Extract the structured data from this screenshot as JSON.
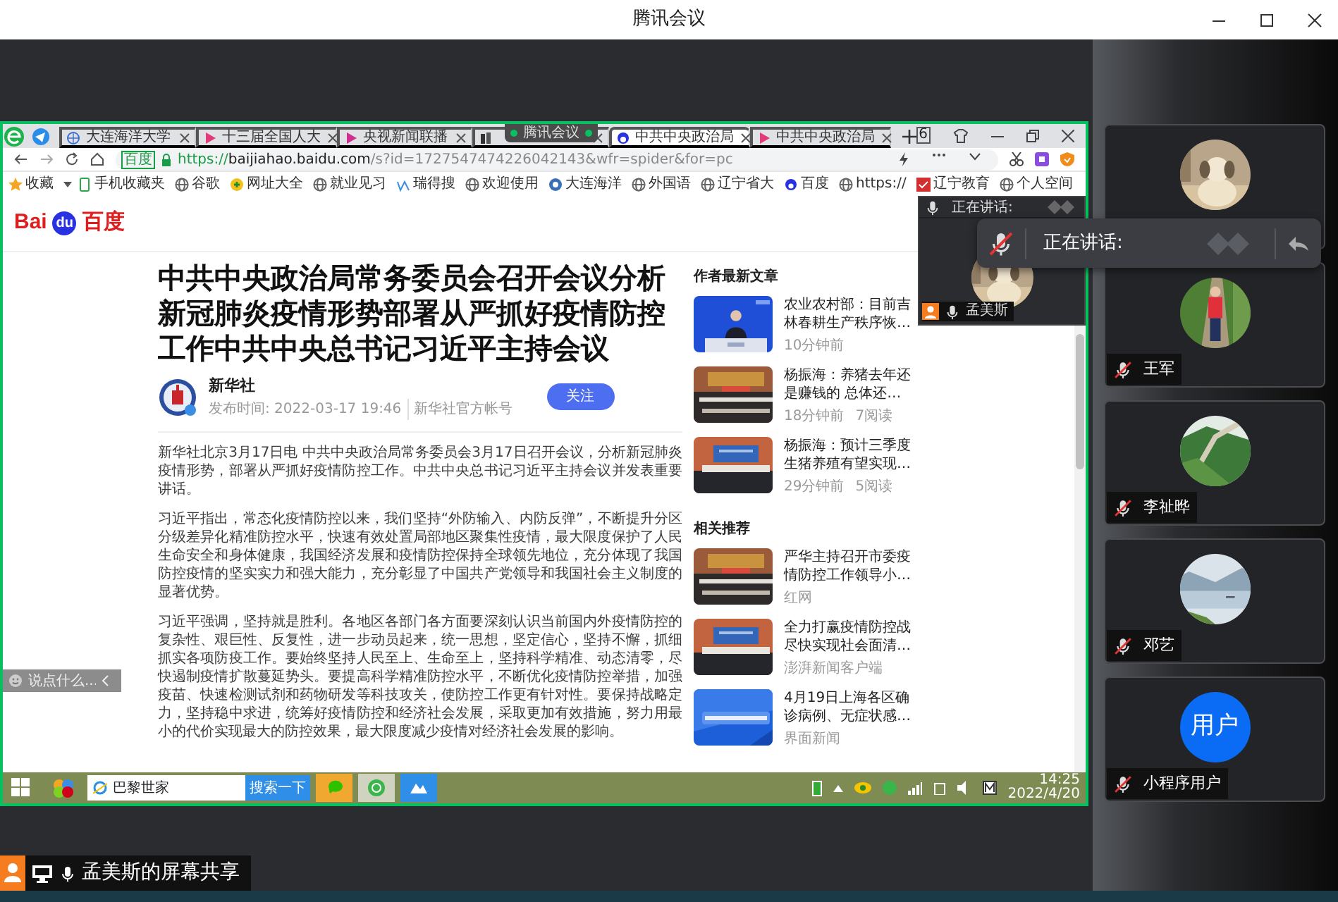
{
  "window": {
    "title": "腾讯会议"
  },
  "shared_screen": {
    "browser": {
      "tabs": [
        {
          "label": "大连海洋大学",
          "selected": false
        },
        {
          "label": "十三届全国人大",
          "selected": false
        },
        {
          "label": "央视新闻联播",
          "selected": false
        },
        {
          "selected": false
        },
        {
          "label": "中共中央政治局",
          "selected": true
        },
        {
          "label": "中共中央政治局",
          "selected": false
        }
      ],
      "window_badge": "6",
      "address": {
        "site_badge": "百度",
        "scheme": "https://",
        "host": "baijiahao.baidu.com",
        "rest": "/s?id=1727547474226042143&wfr=spider&for=pc"
      },
      "bookmarks": [
        "收藏",
        "手机收藏夹",
        "谷歌",
        "网址大全",
        "就业见习",
        "瑞得搜",
        "欢迎使用",
        "大连海洋",
        "外国语",
        "辽宁省大",
        "百度",
        "https://",
        "辽宁教育",
        "个人空间"
      ],
      "logo": {
        "left": "Bai",
        "paw": "du",
        "right": "百度"
      },
      "article": {
        "title": "中共中央政治局常务委员会召开会议分析新冠肺炎疫情形势部署从严抓好疫情防控工作中共中央总书记习近平主持会议",
        "author": "新华社",
        "time": "发布时间: 2022-03-17 19:46",
        "source": "新华社官方帐号",
        "follow_button": "关注",
        "paragraphs": [
          "新华社北京3月17日电 中共中央政治局常务委员会3月17日召开会议，分析新冠肺炎疫情形势，部署从严抓好疫情防控工作。中共中央总书记习近平主持会议并发表重要讲话。",
          "习近平指出，常态化疫情防控以来，我们坚持“外防输入、内防反弹”，不断提升分区分级差异化精准防控水平，快速有效处置局部地区聚集性疫情，最大限度保护了人民生命安全和身体健康，我国经济发展和疫情防控保持全球领先地位，充分体现了我国防控疫情的坚实实力和强大能力，充分彰显了中国共产党领导和我国社会主义制度的显著优势。",
          "习近平强调，坚持就是胜利。各地区各部门各方面要深刻认识当前国内外疫情防控的复杂性、艰巨性、反复性，进一步动员起来，统一思想，坚定信心，坚持不懈，抓细抓实各项防疫工作。要始终坚持人民至上、生命至上，坚持科学精准、动态清零，尽快遏制疫情扩散蔓延势头。要提高科学精准防控水平，不断优化疫情防控举措，加强疫苗、快速检测试剂和药物研发等科技攻关，使防控工作更有针对性。要保持战略定力，坚持稳中求进，统筹好疫情防控和经济社会发展，采取更加有效措施，努力用最小的代价实现最大的防控效果，最大限度减少疫情对经济社会发展的影响。"
        ]
      },
      "sidebar": [
        {
          "heading": "作者最新文章",
          "items": [
            {
              "title": "农业农村部：目前吉林春耕生产秩序恢…",
              "meta": [
                "10分钟前"
              ]
            },
            {
              "title": "杨振海：养猪去年还是赚钱的 总体还…",
              "meta": [
                "18分钟前",
                "7阅读"
              ]
            },
            {
              "title": "杨振海：预计三季度生猪养殖有望实现…",
              "meta": [
                "29分钟前",
                "5阅读"
              ]
            }
          ]
        },
        {
          "heading": "相关推荐",
          "items": [
            {
              "title": "严华主持召开市委疫情防控工作领导小…",
              "meta": [
                "红网"
              ]
            },
            {
              "title": "全力打赢疫情防控战尽快实现社会面清…",
              "meta": [
                "澎湃新闻客户端"
              ]
            },
            {
              "title": "4月19日上海各区确诊病例、无症状感…",
              "meta": [
                "界面新闻"
              ]
            }
          ]
        }
      ]
    },
    "meeting_badge": "腾讯会议",
    "chat_box": {
      "placeholder": "说点什么..."
    },
    "taskbar": {
      "search_value": "巴黎世家",
      "search_button": "搜索一下",
      "time": "14:25",
      "date": "2022/4/20"
    }
  },
  "speaker_window": {
    "label": "正在讲话:",
    "name": "孟美斯"
  },
  "speaking_popup": {
    "label": "正在讲话:",
    "muted": true
  },
  "participants": [
    {
      "avatar": {
        "kind": "picture"
      }
    },
    {
      "name": "王军",
      "muted": true,
      "avatar": {
        "kind": "picture"
      }
    },
    {
      "name": "李祉晔",
      "muted": true,
      "avatar": {
        "kind": "picture"
      }
    },
    {
      "name": "邓艺",
      "muted": true,
      "avatar": {
        "kind": "picture"
      }
    },
    {
      "name": "小程序用户",
      "muted": true,
      "avatar": {
        "kind": "initials",
        "text": "用户"
      }
    }
  ],
  "share_label": "孟美斯的屏幕共享"
}
